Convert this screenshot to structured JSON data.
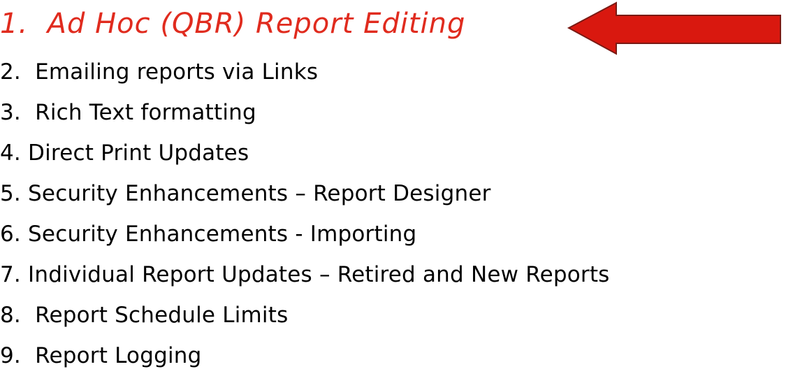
{
  "accent_color": "#e02b1e",
  "arrow": {
    "icon": "left-arrow-icon",
    "fill": "#d9180f",
    "stroke": "#7a1a14"
  },
  "items": [
    {
      "number": "1.",
      "text": "Ad Hoc (QBR) Report Editing",
      "highlighted": true
    },
    {
      "number": "2.",
      "text": "Emailing reports via Links"
    },
    {
      "number": "3.",
      "text": "Rich Text formatting"
    },
    {
      "number": "4.",
      "text": "Direct Print Updates"
    },
    {
      "number": "5.",
      "text": "Security Enhancements – Report Designer"
    },
    {
      "number": "6.",
      "text": "Security Enhancements - Importing"
    },
    {
      "number": "7.",
      "text": "Individual Report Updates – Retired and New Reports"
    },
    {
      "number": "8.",
      "text": "Report Schedule Limits"
    },
    {
      "number": "9.",
      "text": "Report Logging"
    }
  ]
}
